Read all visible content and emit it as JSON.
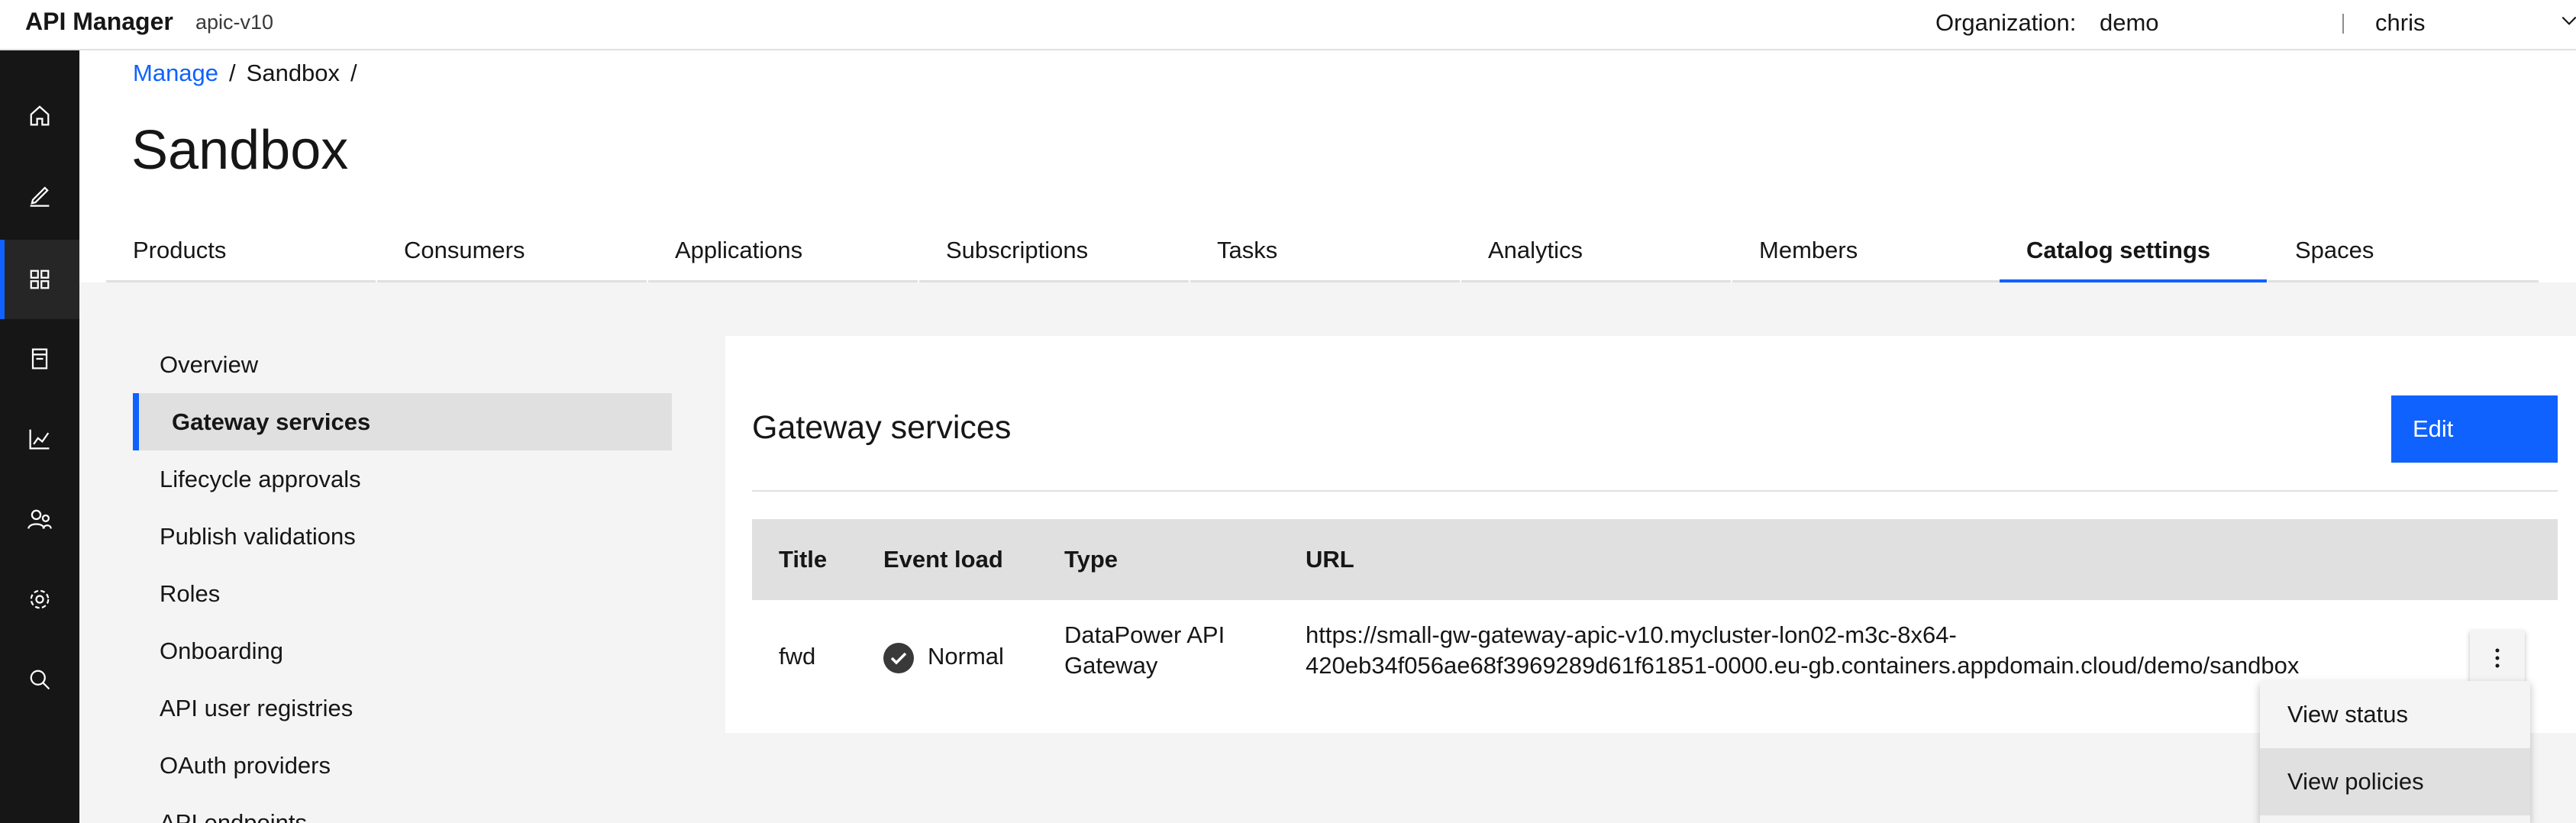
{
  "header": {
    "app_name": "API Manager",
    "env_name": "apic-v10",
    "org_label": "Organization:",
    "org_value": "demo",
    "user_name": "chris"
  },
  "rail": {
    "items": [
      {
        "icon": "home-icon"
      },
      {
        "icon": "edit-icon"
      },
      {
        "icon": "manage-grid-icon",
        "active": true
      },
      {
        "icon": "catalog-book-icon"
      },
      {
        "icon": "analytics-chart-icon"
      },
      {
        "icon": "members-icon"
      },
      {
        "icon": "settings-gear-icon"
      },
      {
        "icon": "search-icon"
      }
    ]
  },
  "breadcrumb": {
    "items": [
      "Manage",
      "Sandbox"
    ],
    "separator": "/"
  },
  "page": {
    "title": "Sandbox"
  },
  "tabs": [
    {
      "label": "Products"
    },
    {
      "label": "Consumers"
    },
    {
      "label": "Applications"
    },
    {
      "label": "Subscriptions"
    },
    {
      "label": "Tasks"
    },
    {
      "label": "Analytics"
    },
    {
      "label": "Members"
    },
    {
      "label": "Catalog settings",
      "active": true
    },
    {
      "label": "Spaces"
    }
  ],
  "settings_nav": [
    {
      "label": "Overview"
    },
    {
      "label": "Gateway services",
      "active": true
    },
    {
      "label": "Lifecycle approvals"
    },
    {
      "label": "Publish validations"
    },
    {
      "label": "Roles"
    },
    {
      "label": "Onboarding"
    },
    {
      "label": "API user registries"
    },
    {
      "label": "OAuth providers"
    },
    {
      "label": "API endpoints"
    }
  ],
  "panel": {
    "title": "Gateway services",
    "edit_label": "Edit"
  },
  "table": {
    "columns": [
      "Title",
      "Event load",
      "Type",
      "URL"
    ],
    "rows": [
      {
        "title": "fwd",
        "event_load": "Normal",
        "type_line1": "DataPower API",
        "type_line2": "Gateway",
        "url_line1": "https://small-gw-gateway-apic-v10.mycluster-lon02-m3c-8x64-",
        "url_line2": "420eb34f056ae68f3969289d61f61851-0000.eu-gb.containers.appdomain.cloud/demo/sandbox"
      }
    ]
  },
  "overflow_menu": {
    "items": [
      "View status",
      "View policies"
    ]
  },
  "colors": {
    "accent": "#0f62fe",
    "rail_bg": "#161616",
    "content_bg": "#f4f4f4",
    "table_header_bg": "#e0e0e0"
  }
}
